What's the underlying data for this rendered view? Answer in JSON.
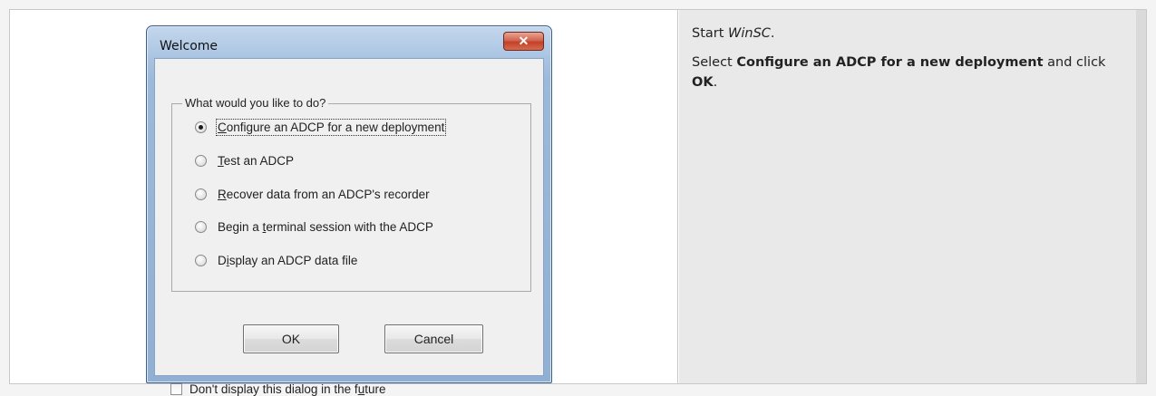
{
  "dialog": {
    "title": "Welcome",
    "close_icon": "close-icon",
    "group_label": "What would you like to do?",
    "options": [
      {
        "pre": "",
        "key": "C",
        "post": "onfigure an ADCP for a new deployment",
        "checked": true
      },
      {
        "pre": "",
        "key": "T",
        "post": "est an ADCP",
        "checked": false
      },
      {
        "pre": "",
        "key": "R",
        "post": "ecover data from an ADCP's recorder",
        "checked": false
      },
      {
        "pre": "Begin a ",
        "key": "t",
        "post": "erminal session with the ADCP",
        "checked": false
      },
      {
        "pre": "D",
        "key": "i",
        "post": "splay an ADCP data file",
        "checked": false
      }
    ],
    "ok_label": "OK",
    "cancel_label": "Cancel",
    "checkbox": {
      "pre": "Don't display this dialog in the f",
      "key": "u",
      "post": "ture",
      "checked": false
    }
  },
  "instructions": {
    "step1": {
      "pre": "Start ",
      "italic": "WinSC",
      "post": "."
    },
    "step2": {
      "pre": "Select ",
      "bold": "Configure an ADCP for a new deployment",
      "mid": " and click ",
      "bold2": "OK",
      "post": "."
    }
  },
  "colors": {
    "close_button": "#c2412b",
    "title_gradient_top": "#c4d7ec",
    "dialog_face": "#f0f0f0",
    "instructions_bg": "#e9e9e9"
  }
}
